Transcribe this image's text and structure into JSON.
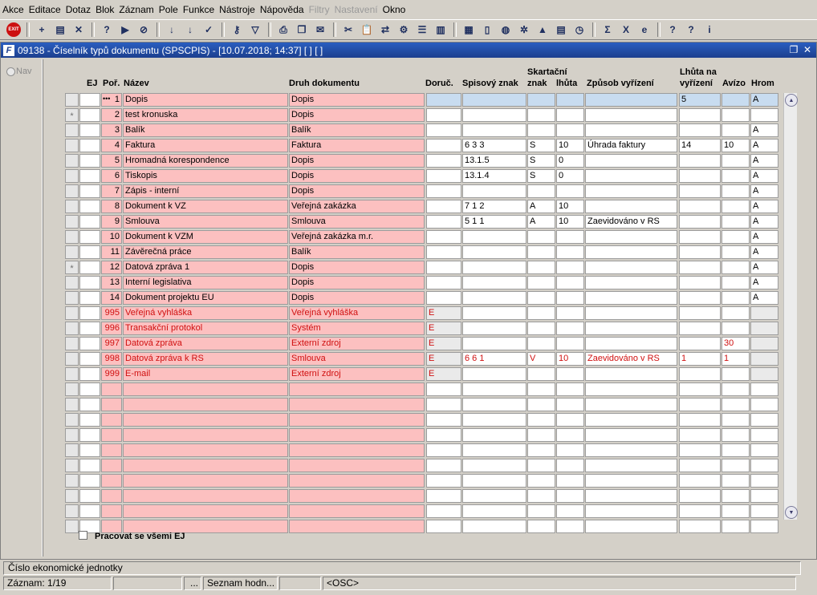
{
  "menu": [
    "Akce",
    "Editace",
    "Dotaz",
    "Blok",
    "Záznam",
    "Pole",
    "Funkce",
    "Nástroje",
    "Nápověda",
    "Filtry",
    "Nastavení",
    "Okno"
  ],
  "menu_disabled": [
    false,
    false,
    false,
    false,
    false,
    false,
    false,
    false,
    false,
    true,
    true,
    false
  ],
  "toolbar": {
    "exit_label": "EXIT",
    "icons": [
      "exit-icon",
      "insert-record-icon",
      "save-icon",
      "delete-record-icon",
      "query-icon",
      "execute-query-icon",
      "cancel-query-icon",
      "sort-ascending-icon",
      "sort-descending-icon",
      "checkmark-icon",
      "key-icon",
      "filter-icon",
      "print-icon",
      "copy-icon",
      "mail-icon",
      "cut-icon",
      "paste-icon",
      "transfer-icon",
      "tools-icon",
      "list-icon",
      "columns-icon",
      "calendar-icon",
      "document-icon",
      "globe-icon",
      "settings-icon",
      "chart-icon",
      "report-icon",
      "clock-icon",
      "sum-icon",
      "excel-icon",
      "browser-icon",
      "help-icon",
      "context-help-icon",
      "info-icon"
    ]
  },
  "window": {
    "title": "09138 - Číselník typů dokumentu (SPSCPIS) - [10.07.2018; 14:37] [ ] [ ]"
  },
  "nav": {
    "label": "Nav"
  },
  "columns": {
    "ej": "EJ",
    "por": "Poř.",
    "nazev": "Název",
    "druh": "Druh dokumentu",
    "doruc": "Doruč.",
    "spis": "Spisový znak",
    "skart_top": "Skartační",
    "skart_bottom": "znak",
    "lhuta": "lhůta",
    "zpusob": "Způsob vyřízení",
    "lhuta_vyr_top": "Lhůta na",
    "lhuta_vyr_bottom": "vyřízení",
    "avizo": "Avízo",
    "hrom": "Hrom"
  },
  "rows": [
    {
      "marker": "",
      "por": "1",
      "nazev": "Dopis",
      "druh": "Dopis",
      "doruc": "",
      "spis": "",
      "skart": "",
      "lhuta": "",
      "zpusob": "",
      "lhuta_vyr": "5",
      "avizo": "",
      "hrom": "A",
      "system": false,
      "current": true
    },
    {
      "marker": "*",
      "por": "2",
      "nazev": "test kronuska",
      "druh": "Dopis",
      "doruc": "",
      "spis": "",
      "skart": "",
      "lhuta": "",
      "zpusob": "",
      "lhuta_vyr": "",
      "avizo": "",
      "hrom": "",
      "system": false
    },
    {
      "marker": "",
      "por": "3",
      "nazev": "Balík",
      "druh": "Balík",
      "doruc": "",
      "spis": "",
      "skart": "",
      "lhuta": "",
      "zpusob": "",
      "lhuta_vyr": "",
      "avizo": "",
      "hrom": "A",
      "system": false
    },
    {
      "marker": "",
      "por": "4",
      "nazev": "Faktura",
      "druh": "Faktura",
      "doruc": "",
      "spis": "6 3 3",
      "skart": "S",
      "lhuta": "10",
      "zpusob": "Úhrada faktury",
      "lhuta_vyr": "14",
      "avizo": "10",
      "hrom": "A",
      "system": false
    },
    {
      "marker": "",
      "por": "5",
      "nazev": "Hromadná korespondence",
      "druh": "Dopis",
      "doruc": "",
      "spis": "13.1.5",
      "skart": "S",
      "lhuta": "0",
      "zpusob": "",
      "lhuta_vyr": "",
      "avizo": "",
      "hrom": "A",
      "system": false
    },
    {
      "marker": "",
      "por": "6",
      "nazev": "Tiskopis",
      "druh": "Dopis",
      "doruc": "",
      "spis": "13.1.4",
      "skart": "S",
      "lhuta": "0",
      "zpusob": "",
      "lhuta_vyr": "",
      "avizo": "",
      "hrom": "A",
      "system": false
    },
    {
      "marker": "",
      "por": "7",
      "nazev": "Zápis - interní",
      "druh": "Dopis",
      "doruc": "",
      "spis": "",
      "skart": "",
      "lhuta": "",
      "zpusob": "",
      "lhuta_vyr": "",
      "avizo": "",
      "hrom": "A",
      "system": false
    },
    {
      "marker": "",
      "por": "8",
      "nazev": "Dokument k VZ",
      "druh": "Veřejná zakázka",
      "doruc": "",
      "spis": "7 1 2",
      "skart": "A",
      "lhuta": "10",
      "zpusob": "",
      "lhuta_vyr": "",
      "avizo": "",
      "hrom": "A",
      "system": false
    },
    {
      "marker": "",
      "por": "9",
      "nazev": "Smlouva",
      "druh": "Smlouva",
      "doruc": "",
      "spis": "5 1 1",
      "skart": "A",
      "lhuta": "10",
      "zpusob": "Zaevidováno v RS",
      "lhuta_vyr": "",
      "avizo": "",
      "hrom": "A",
      "system": false
    },
    {
      "marker": "",
      "por": "10",
      "nazev": "Dokument k VZM",
      "druh": "Veřejná zakázka m.r.",
      "doruc": "",
      "spis": "",
      "skart": "",
      "lhuta": "",
      "zpusob": "",
      "lhuta_vyr": "",
      "avizo": "",
      "hrom": "A",
      "system": false
    },
    {
      "marker": "",
      "por": "11",
      "nazev": "Závěrečná práce",
      "druh": "Balík",
      "doruc": "",
      "spis": "",
      "skart": "",
      "lhuta": "",
      "zpusob": "",
      "lhuta_vyr": "",
      "avizo": "",
      "hrom": "A",
      "system": false
    },
    {
      "marker": "*",
      "por": "12",
      "nazev": "Datová zpráva 1",
      "druh": "Dopis",
      "doruc": "",
      "spis": "",
      "skart": "",
      "lhuta": "",
      "zpusob": "",
      "lhuta_vyr": "",
      "avizo": "",
      "hrom": "A",
      "system": false
    },
    {
      "marker": "",
      "por": "13",
      "nazev": "Interní legislativa",
      "druh": "Dopis",
      "doruc": "",
      "spis": "",
      "skart": "",
      "lhuta": "",
      "zpusob": "",
      "lhuta_vyr": "",
      "avizo": "",
      "hrom": "A",
      "system": false
    },
    {
      "marker": "",
      "por": "14",
      "nazev": "Dokument projektu EU",
      "druh": "Dopis",
      "doruc": "",
      "spis": "",
      "skart": "",
      "lhuta": "",
      "zpusob": "",
      "lhuta_vyr": "",
      "avizo": "",
      "hrom": "A",
      "system": false
    },
    {
      "marker": "",
      "por": "995",
      "nazev": "Veřejná vyhláška",
      "druh": "Veřejná vyhláška",
      "doruc": "E",
      "spis": "",
      "skart": "",
      "lhuta": "",
      "zpusob": "",
      "lhuta_vyr": "",
      "avizo": "",
      "hrom": "",
      "system": true
    },
    {
      "marker": "",
      "por": "996",
      "nazev": "Transakční protokol",
      "druh": "Systém",
      "doruc": "E",
      "spis": "",
      "skart": "",
      "lhuta": "",
      "zpusob": "",
      "lhuta_vyr": "",
      "avizo": "",
      "hrom": "",
      "system": true
    },
    {
      "marker": "",
      "por": "997",
      "nazev": "Datová zpráva",
      "druh": "Externí zdroj",
      "doruc": "E",
      "spis": "",
      "skart": "",
      "lhuta": "",
      "zpusob": "",
      "lhuta_vyr": "",
      "avizo": "30",
      "hrom": "",
      "system": true
    },
    {
      "marker": "",
      "por": "998",
      "nazev": "Datová zpráva k RS",
      "druh": "Smlouva",
      "doruc": "E",
      "spis": "6 6 1",
      "skart": "V",
      "lhuta": "10",
      "zpusob": "Zaevidováno v RS",
      "lhuta_vyr": "1",
      "avizo": "1",
      "hrom": "",
      "system": true
    },
    {
      "marker": "",
      "por": "999",
      "nazev": "E-mail",
      "druh": "Externí zdroj",
      "doruc": "E",
      "spis": "",
      "skart": "",
      "lhuta": "",
      "zpusob": "",
      "lhuta_vyr": "",
      "avizo": "",
      "hrom": "",
      "system": true
    }
  ],
  "empty_rows": 10,
  "checkbox": {
    "label": "Pracovat se všemi EJ",
    "checked": false
  },
  "hint": "Číslo ekonomické jednotky",
  "status": [
    "Záznam: 1/19",
    "",
    "...",
    "Seznam hodn...",
    "",
    "<OSC>"
  ],
  "colors": {
    "required": "#fcc0c0",
    "current": "#c8dcf0",
    "system_text": "#d01010",
    "title_bar": "#1c3f8e"
  }
}
